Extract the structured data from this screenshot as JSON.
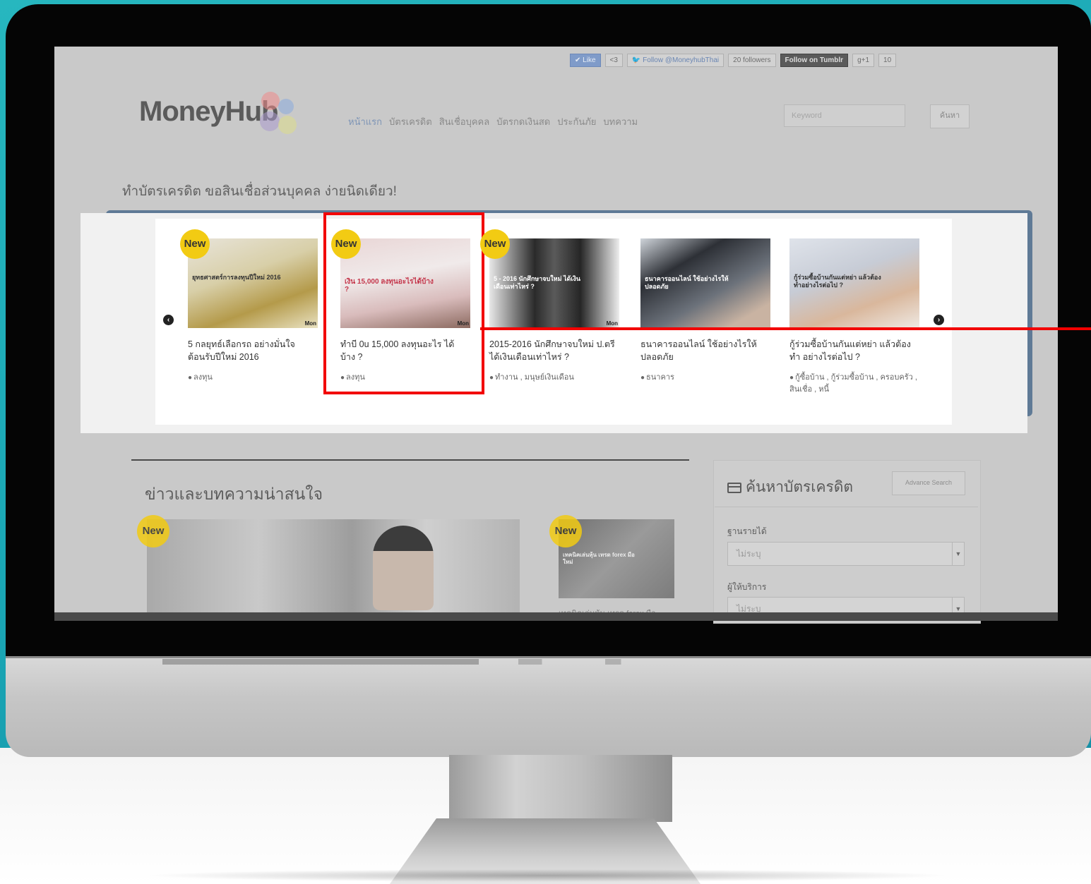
{
  "social": {
    "like": "✔ Like",
    "like_count": "<3",
    "follow_twitter": "Follow @MoneyhubThai",
    "followers": "20 followers",
    "tumblr": "Follow on Tumblr",
    "gplus": "g+1",
    "gplus_count": "10"
  },
  "logo": "MoneyHub",
  "nav": [
    "หน้าแรก",
    "บัตรเครดิต",
    "สินเชื่อบุคคล",
    "บัตรกดเงินสด",
    "ประกันภัย",
    "บทความ"
  ],
  "search": {
    "placeholder": "Keyword",
    "button": "ค้นหา"
  },
  "tagline": "ทำบัตรเครดิต ขอสินเชื่อส่วนบุคคล ง่ายนิดเดียว!",
  "badge": "New",
  "cards": [
    {
      "image_caption": "ยุทธศาสตร์การลงทุนปีใหม่ 2016",
      "image_tag": "Mon",
      "title": "5 กลยุทธ์เลือกรถ อย่างมั่นใจ ต้อนรับปีใหม่ 2016",
      "tags": "ลงทุน"
    },
    {
      "image_caption": "เงิน 15,000 ลงทุนอะไรได้บ้าง ?",
      "image_tag": "Mon",
      "title": "ทำบี 0u 15,000 ลงทุนอะไร ได้บ้าง ?",
      "tags": "ลงทุน"
    },
    {
      "image_caption": "5 - 2016 นักศึกษาจบใหม่ ได้เงินเดือนเท่าไหร่ ?",
      "image_tag": "Mon",
      "title": "2015-2016 นักศึกษาจบใหม่ ป.ตรี ได้เงินเดือนเท่าไหร่ ?",
      "tags": "ทำงาน , มนุษย์เงินเดือน"
    },
    {
      "image_caption": "ธนาคารออนไลน์ ใช้อย่างไรให้ปลอดภัย",
      "image_tag": "",
      "title": "ธนาคารออนไลน์ ใช้อย่างไรให้ ปลอดภัย",
      "tags": "ธนาคาร"
    },
    {
      "image_caption": "กู้ร่วมซื้อบ้านกันแต่หย่า แล้วต้องทำอย่างไรต่อไป ?",
      "image_tag": "",
      "title": "กู้ร่วมซื้อบ้านกันแต่หย่า แล้วต้องทำ อย่างไรต่อไป ?",
      "tags": "กู้ซื้อบ้าน , กู้ร่วมซื้อบ้าน , ครอบครัว , สินเชื่อ , หนี้"
    }
  ],
  "news": {
    "heading": "ข่าวและบทความน่าสนใจ",
    "thumb_caption": "เทคนิคเล่นหุ้น เทรด forex มือใหม่",
    "thumb_title": "เทคนิคเล่นหุ้น เทรด forex มือ"
  },
  "side": {
    "heading": "ค้นหาบัตรเครดิต",
    "advance": "Advance Search",
    "income_label": "ฐานรายได้",
    "income_value": "ไม่ระบุ",
    "provider_label": "ผู้ให้บริการ",
    "provider_value": "ไม่ระบุ"
  },
  "colors": {
    "highlight": "#f20000",
    "badge": "#f2cb13",
    "teal": "#1aa7b5"
  }
}
